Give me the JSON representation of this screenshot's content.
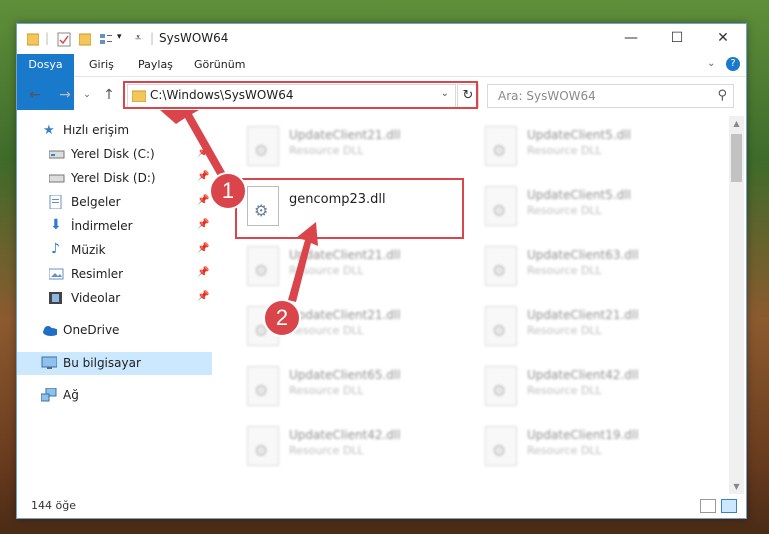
{
  "window": {
    "title": "SysWOW64",
    "minimize": "—",
    "maximize": "☐",
    "close": "✕"
  },
  "ribbon": {
    "tabs": [
      "Dosya",
      "Giriş",
      "Paylaş",
      "Görünüm"
    ]
  },
  "address": {
    "path": "C:\\Windows\\SysWOW64",
    "search_placeholder": "Ara: SysWOW64"
  },
  "sidebar": {
    "items": [
      {
        "label": "Hızlı erişim",
        "icon": "star-icon"
      },
      {
        "label": "Yerel Disk (C:)",
        "icon": "drive-icon"
      },
      {
        "label": "Yerel Disk (D:)",
        "icon": "drive-icon"
      },
      {
        "label": "Belgeler",
        "icon": "documents-icon"
      },
      {
        "label": "İndirmeler",
        "icon": "download-icon"
      },
      {
        "label": "Müzik",
        "icon": "music-icon"
      },
      {
        "label": "Resimler",
        "icon": "pictures-icon"
      },
      {
        "label": "Videolar",
        "icon": "video-icon"
      },
      {
        "label": "OneDrive",
        "icon": "cloud-icon"
      },
      {
        "label": "Bu bilgisayar",
        "icon": "computer-icon"
      },
      {
        "label": "Ağ",
        "icon": "network-icon"
      }
    ]
  },
  "files": [
    {
      "name": "UpdateClient21.dll",
      "type": "Resource DLL"
    },
    {
      "name": "UpdateClient5.dll",
      "type": "Resource DLL"
    },
    {
      "name": "gencomp23.dll",
      "type": ""
    },
    {
      "name": "UpdateClient5.dll",
      "type": "Resource DLL"
    },
    {
      "name": "UpdateClient21.dll",
      "type": "Resource DLL"
    },
    {
      "name": "UpdateClient63.dll",
      "type": "Resource DLL"
    },
    {
      "name": "UpdateClient21.dll",
      "type": "Resource DLL"
    },
    {
      "name": "UpdateClient21.dll",
      "type": "Resource DLL"
    },
    {
      "name": "UpdateClient65.dll",
      "type": "Resource DLL"
    },
    {
      "name": "UpdateClient42.dll",
      "type": "Resource DLL"
    },
    {
      "name": "UpdateClient42.dll",
      "type": "Resource DLL"
    },
    {
      "name": "UpdateClient19.dll",
      "type": "Resource DLL"
    }
  ],
  "status": {
    "count": "144 öğe"
  },
  "annotations": {
    "marker1": "1",
    "marker2": "2",
    "color": "#d9454b"
  },
  "colors": {
    "file_tab": "#1979ca",
    "selected_nav": "#cce8ff"
  }
}
